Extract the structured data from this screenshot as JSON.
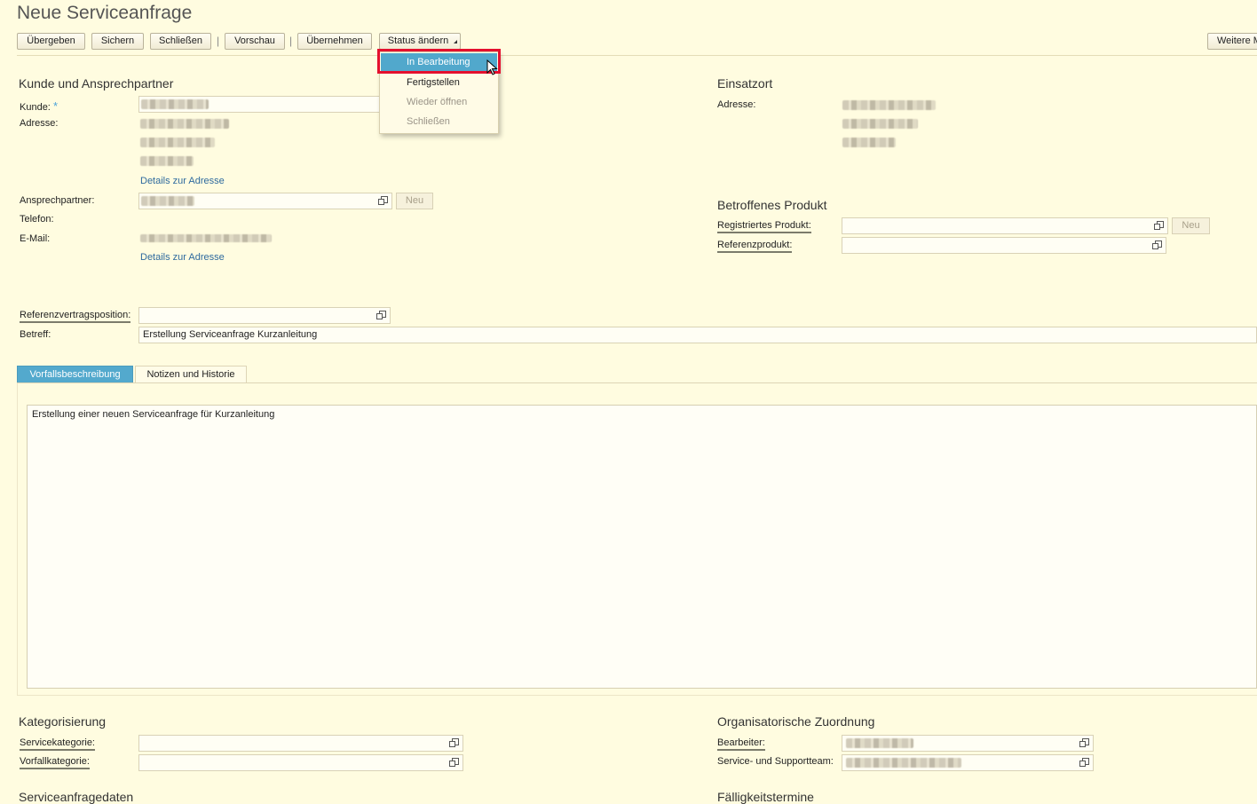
{
  "page": {
    "title": "Neue Serviceanfrage"
  },
  "toolbar": {
    "uebergeben": "Übergeben",
    "sichern": "Sichern",
    "schliessen": "Schließen",
    "separator": "|",
    "vorschau": "Vorschau",
    "uebernehmen": "Übernehmen",
    "status_aendern": "Status ändern",
    "weitere": "Weitere M"
  },
  "status_menu": {
    "items": [
      {
        "label": "In Bearbeitung",
        "state": "highlighted"
      },
      {
        "label": "Fertigstellen",
        "state": "enabled"
      },
      {
        "label": "Wieder öffnen",
        "state": "disabled"
      },
      {
        "label": "Schließen",
        "state": "disabled"
      }
    ]
  },
  "kunde_section": {
    "title": "Kunde und Ansprechpartner",
    "kunde_label": "Kunde:",
    "required_marker": "*",
    "adresse_label": "Adresse:",
    "details_link": "Details zur Adresse",
    "ansprechpartner_label": "Ansprechpartner:",
    "neu_button": "Neu",
    "telefon_label": "Telefon:",
    "email_label": "E-Mail:",
    "details_link_2": "Details zur Adresse"
  },
  "einsatzort_section": {
    "title": "Einsatzort",
    "adresse_label": "Adresse:"
  },
  "produkt_section": {
    "title": "Betroffenes Produkt",
    "registriertes_label": "Registriertes Produkt:",
    "neu_button": "Neu",
    "referenzprodukt_label": "Referenzprodukt:"
  },
  "referenz": {
    "vertragsposition_label": "Referenzvertragsposition:",
    "betreff_label": "Betreff:",
    "betreff_value": "Erstellung Serviceanfrage Kurzanleitung"
  },
  "tabs": {
    "items": [
      {
        "label": "Vorfallsbeschreibung",
        "active": true
      },
      {
        "label": "Notizen und Historie",
        "active": false
      }
    ],
    "description_text": "Erstellung einer neuen Serviceanfrage für Kurzanleitung"
  },
  "kategorisierung": {
    "title": "Kategorisierung",
    "servicekategorie_label": "Servicekategorie:",
    "vorfallkategorie_label": "Vorfallkategorie:"
  },
  "organisatorisch": {
    "title": "Organisatorische Zuordnung",
    "bearbeiter_label": "Bearbeiter:",
    "team_label": "Service- und Supportteam:"
  },
  "bottom": {
    "serviceanfragedaten": "Serviceanfragedaten",
    "faelligkeitstermine": "Fälligkeitstermine"
  },
  "colors": {
    "background": "#fffce0",
    "accent": "#53a9cd",
    "highlight_box": "#e4102e",
    "link": "#2e6a9e"
  },
  "icons": {
    "value_help": "value-help-icon",
    "dropdown": "dropdown-arrow-icon",
    "cursor": "mouse-cursor-icon"
  }
}
